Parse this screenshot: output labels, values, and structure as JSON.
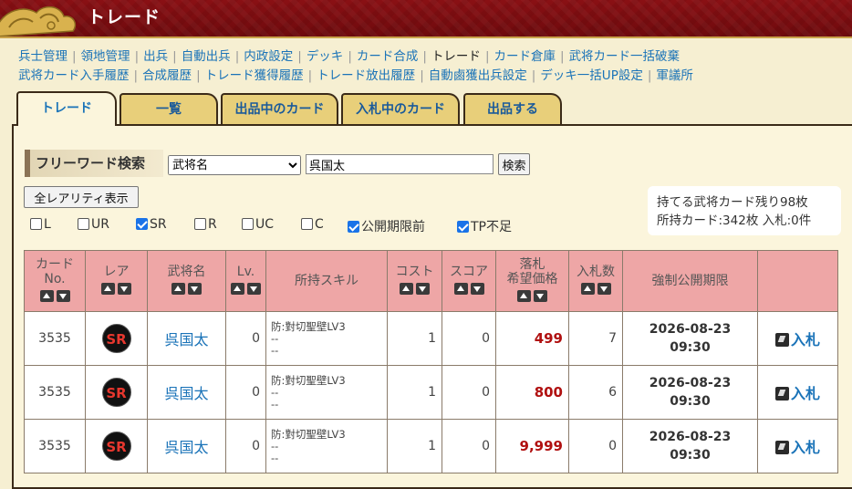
{
  "header": {
    "title": "トレード"
  },
  "nav": {
    "row1": [
      "兵士管理",
      "領地管理",
      "出兵",
      "自動出兵",
      "内政設定",
      "デッキ",
      "カード合成",
      "トレード",
      "カード倉庫",
      "武将カード一括破棄"
    ],
    "row2": [
      "武将カード入手履歴",
      "合成履歴",
      "トレード獲得履歴",
      "トレード放出履歴",
      "自動鹵獲出兵設定",
      "デッキ一括UP設定",
      "軍議所"
    ],
    "current": "トレード"
  },
  "tabs": [
    "トレード",
    "一覧",
    "出品中のカード",
    "入札中のカード",
    "出品する"
  ],
  "search": {
    "label": "フリーワード検索",
    "select_value": "武将名",
    "input_value": "呉国太",
    "button": "検索"
  },
  "all_rarity_button": "全レアリティ表示",
  "filters": [
    {
      "label": "L",
      "checked": false
    },
    {
      "label": "UR",
      "checked": false
    },
    {
      "label": "SR",
      "checked": true
    },
    {
      "label": "R",
      "checked": false
    },
    {
      "label": "UC",
      "checked": false
    },
    {
      "label": "C",
      "checked": false
    },
    {
      "label": "公開期限前",
      "checked": true
    },
    {
      "label": "TP不足",
      "checked": true
    }
  ],
  "info": {
    "line1": "持てる武将カード残り98枚",
    "line2": "所持カード:342枚 入札:0件"
  },
  "table": {
    "headers": {
      "card_no_1": "カード",
      "card_no_2": "No.",
      "rare": "レア",
      "name": "武将名",
      "lv": "Lv.",
      "skill": "所持スキル",
      "cost": "コスト",
      "score": "スコア",
      "price_1": "落札",
      "price_2": "希望価格",
      "bids": "入札数",
      "deadline": "強制公開期限"
    },
    "rows": [
      {
        "no": "3535",
        "rare": "SR",
        "name": "呉国太",
        "lv": "0",
        "skill1": "防:對切聖壁LV3",
        "skill2": "--",
        "skill3": "--",
        "cost": "1",
        "score": "0",
        "price": "499",
        "bids": "7",
        "date": "2026-08-23",
        "time": "09:30",
        "bid": "入札"
      },
      {
        "no": "3535",
        "rare": "SR",
        "name": "呉国太",
        "lv": "0",
        "skill1": "防:對切聖壁LV3",
        "skill2": "--",
        "skill3": "--",
        "cost": "1",
        "score": "0",
        "price": "800",
        "bids": "6",
        "date": "2026-08-23",
        "time": "09:30",
        "bid": "入札"
      },
      {
        "no": "3535",
        "rare": "SR",
        "name": "呉国太",
        "lv": "0",
        "skill1": "防:對切聖壁LV3",
        "skill2": "--",
        "skill3": "--",
        "cost": "1",
        "score": "0",
        "price": "9,999",
        "bids": "0",
        "date": "2026-08-23",
        "time": "09:30",
        "bid": "入札"
      }
    ]
  }
}
